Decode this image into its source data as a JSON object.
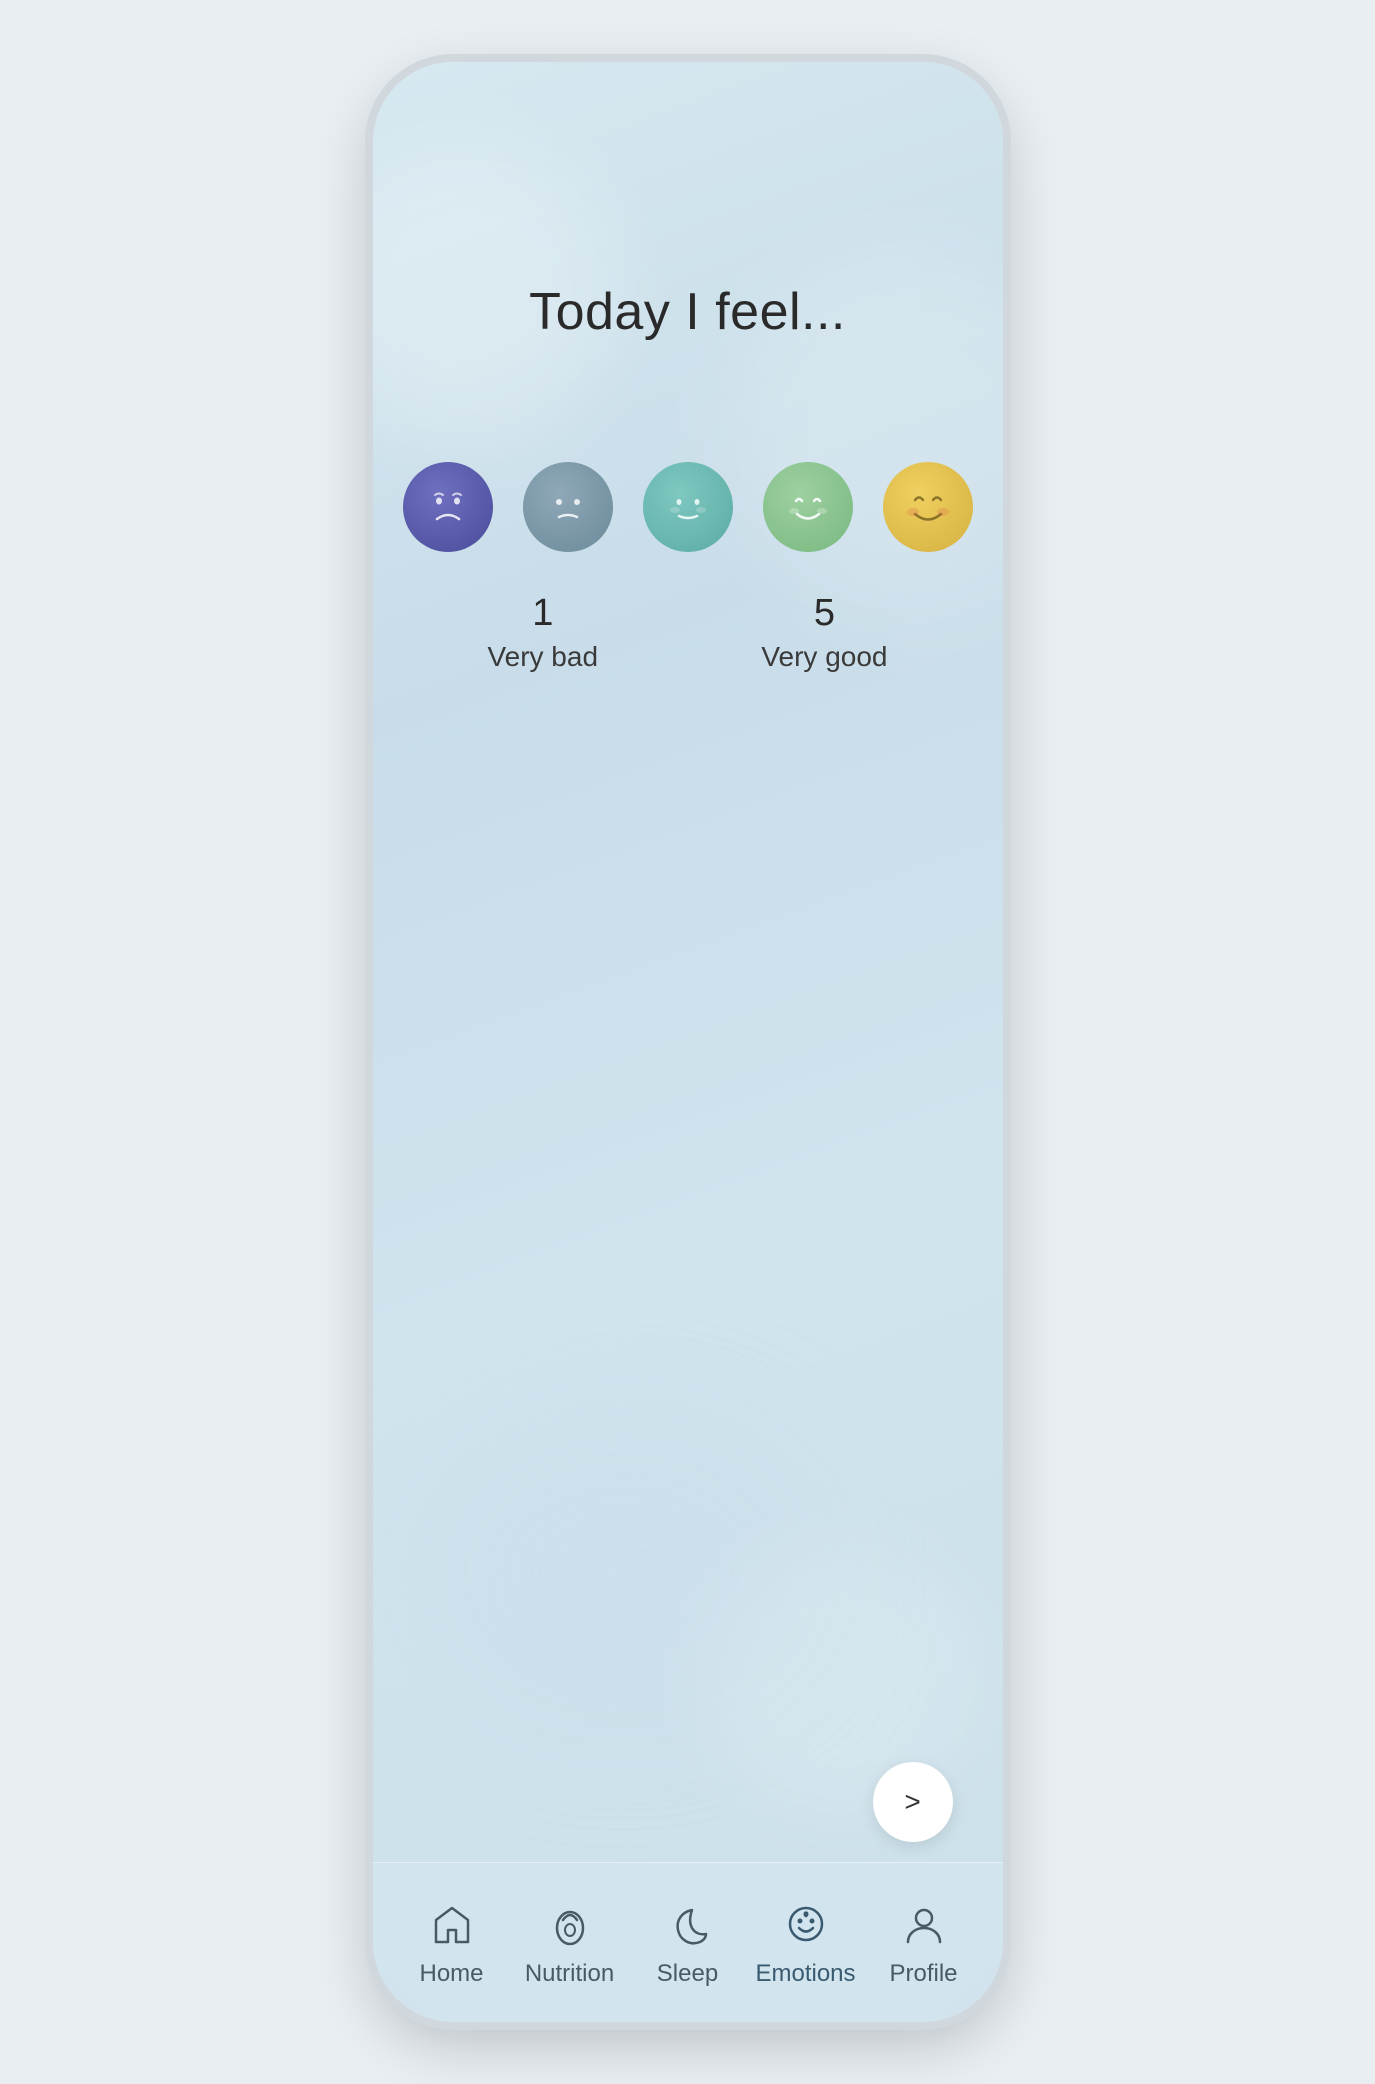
{
  "page": {
    "title": "Today I feel...",
    "background_color": "#cde0ea"
  },
  "emotion_scale": {
    "faces": [
      {
        "id": 1,
        "level": "very_bad",
        "color_start": "#7070c0",
        "color_end": "#4a4a9a"
      },
      {
        "id": 2,
        "level": "bad",
        "color_start": "#8fa8b8",
        "color_end": "#6a8a9a"
      },
      {
        "id": 3,
        "level": "neutral",
        "color_start": "#7ec8c0",
        "color_end": "#5aaba3"
      },
      {
        "id": 4,
        "level": "good",
        "color_start": "#9ed0a0",
        "color_end": "#78b880"
      },
      {
        "id": 5,
        "level": "very_good",
        "color_start": "#f0d060",
        "color_end": "#d4b040"
      }
    ],
    "min_label_number": "1",
    "min_label_text": "Very bad",
    "max_label_number": "5",
    "max_label_text": "Very good"
  },
  "next_button": {
    "label": ">"
  },
  "bottom_nav": {
    "items": [
      {
        "id": "home",
        "label": "Home",
        "icon": "home-icon",
        "active": false
      },
      {
        "id": "nutrition",
        "label": "Nutrition",
        "icon": "nutrition-icon",
        "active": false
      },
      {
        "id": "sleep",
        "label": "Sleep",
        "icon": "sleep-icon",
        "active": false
      },
      {
        "id": "emotions",
        "label": "Emotions",
        "icon": "emotions-icon",
        "active": true
      },
      {
        "id": "profile",
        "label": "Profile",
        "icon": "profile-icon",
        "active": false
      }
    ]
  }
}
